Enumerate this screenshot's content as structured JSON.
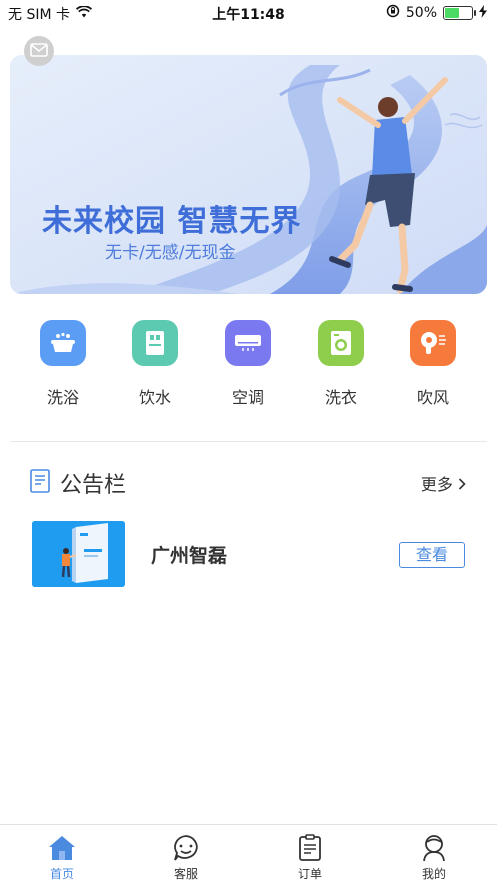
{
  "status_bar": {
    "carrier": "无 SIM 卡",
    "time": "上午11:48",
    "battery": "50%",
    "battery_level": 0.5
  },
  "banner": {
    "title": "未来校园 智慧无界",
    "subtitle": "无卡/无感/无现金",
    "slides": 2,
    "active_slide": 1
  },
  "services": [
    {
      "label": "洗浴",
      "icon": "bath-icon",
      "color": "#5b9cf5"
    },
    {
      "label": "饮水",
      "icon": "water-dispenser-icon",
      "color": "#5ccab0"
    },
    {
      "label": "空调",
      "icon": "air-conditioner-icon",
      "color": "#7a79f0"
    },
    {
      "label": "洗衣",
      "icon": "washing-machine-icon",
      "color": "#8fcd4c"
    },
    {
      "label": "吹风",
      "icon": "hair-dryer-icon",
      "color": "#f57a3c"
    }
  ],
  "notice": {
    "title": "公告栏",
    "more": "更多",
    "items": [
      {
        "title": "广州智磊",
        "button": "查看"
      }
    ]
  },
  "tabs": [
    {
      "label": "首页",
      "icon": "home-icon",
      "active": true
    },
    {
      "label": "客服",
      "icon": "customer-service-icon",
      "active": false
    },
    {
      "label": "订单",
      "icon": "order-icon",
      "active": false
    },
    {
      "label": "我的",
      "icon": "profile-icon",
      "active": false
    }
  ],
  "colors": {
    "accent": "#4a8be0",
    "banner_text": "#3f6ed8"
  }
}
